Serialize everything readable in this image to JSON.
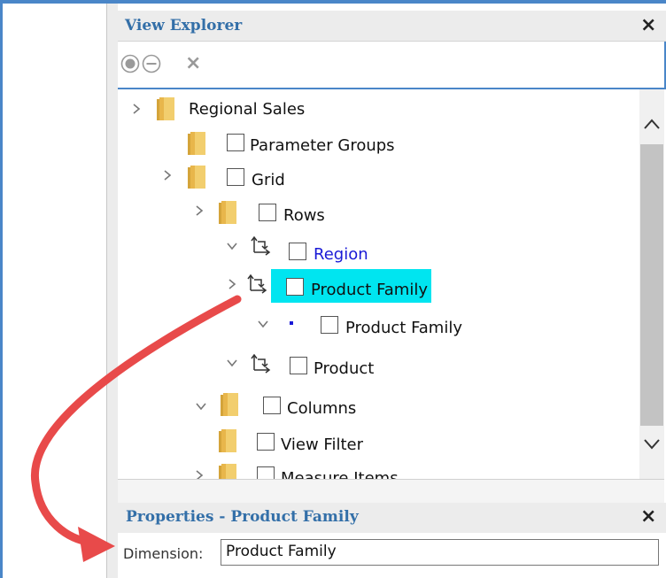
{
  "view_explorer": {
    "title": "View Explorer",
    "close_label": "×",
    "toolbar": {
      "include_icon": "radio-filled-icon",
      "exclude_icon": "minus-circle-icon",
      "remove_label": "×"
    }
  },
  "tree": {
    "items": [
      {
        "label": "Regional Sales",
        "expander": "chevron-right",
        "icon": "folder-icon",
        "checkbox": false
      },
      {
        "label": "Parameter Groups",
        "expander": "none",
        "icon": "folder-icon",
        "checkbox": true
      },
      {
        "label": "Grid",
        "expander": "chevron-right",
        "icon": "folder-icon",
        "checkbox": true
      },
      {
        "label": "Rows",
        "expander": "chevron-right",
        "icon": "folder-icon",
        "checkbox": true
      },
      {
        "label": "Region",
        "expander": "chevron-down",
        "icon": "pivot-icon",
        "checkbox": true,
        "color": "#1a1ad6"
      },
      {
        "label": "Product Family",
        "expander": "chevron-right",
        "icon": "pivot-icon",
        "checkbox": true,
        "highlight": "#00e5f0"
      },
      {
        "label": "Product Family",
        "expander": "chevron-down",
        "icon": "dot-icon",
        "checkbox": true
      },
      {
        "label": "Product",
        "expander": "chevron-down",
        "icon": "pivot-icon",
        "checkbox": true
      },
      {
        "label": "Columns",
        "expander": "chevron-down",
        "icon": "folder-icon",
        "checkbox": true
      },
      {
        "label": "View Filter",
        "expander": "none",
        "icon": "folder-icon",
        "checkbox": true
      },
      {
        "label": "Measure Items",
        "expander": "chevron-right",
        "icon": "folder-icon",
        "checkbox": true
      }
    ]
  },
  "properties": {
    "title": "Properties - Product Family",
    "close_label": "×",
    "dimension_label": "Dimension:",
    "dimension_value": "Product Family"
  },
  "colors": {
    "header_text": "#336fa8",
    "accent_border": "#4a86c8",
    "highlight": "#00e5f0",
    "link_text": "#1a1ad6",
    "annotation_arrow": "#e84a4a"
  }
}
